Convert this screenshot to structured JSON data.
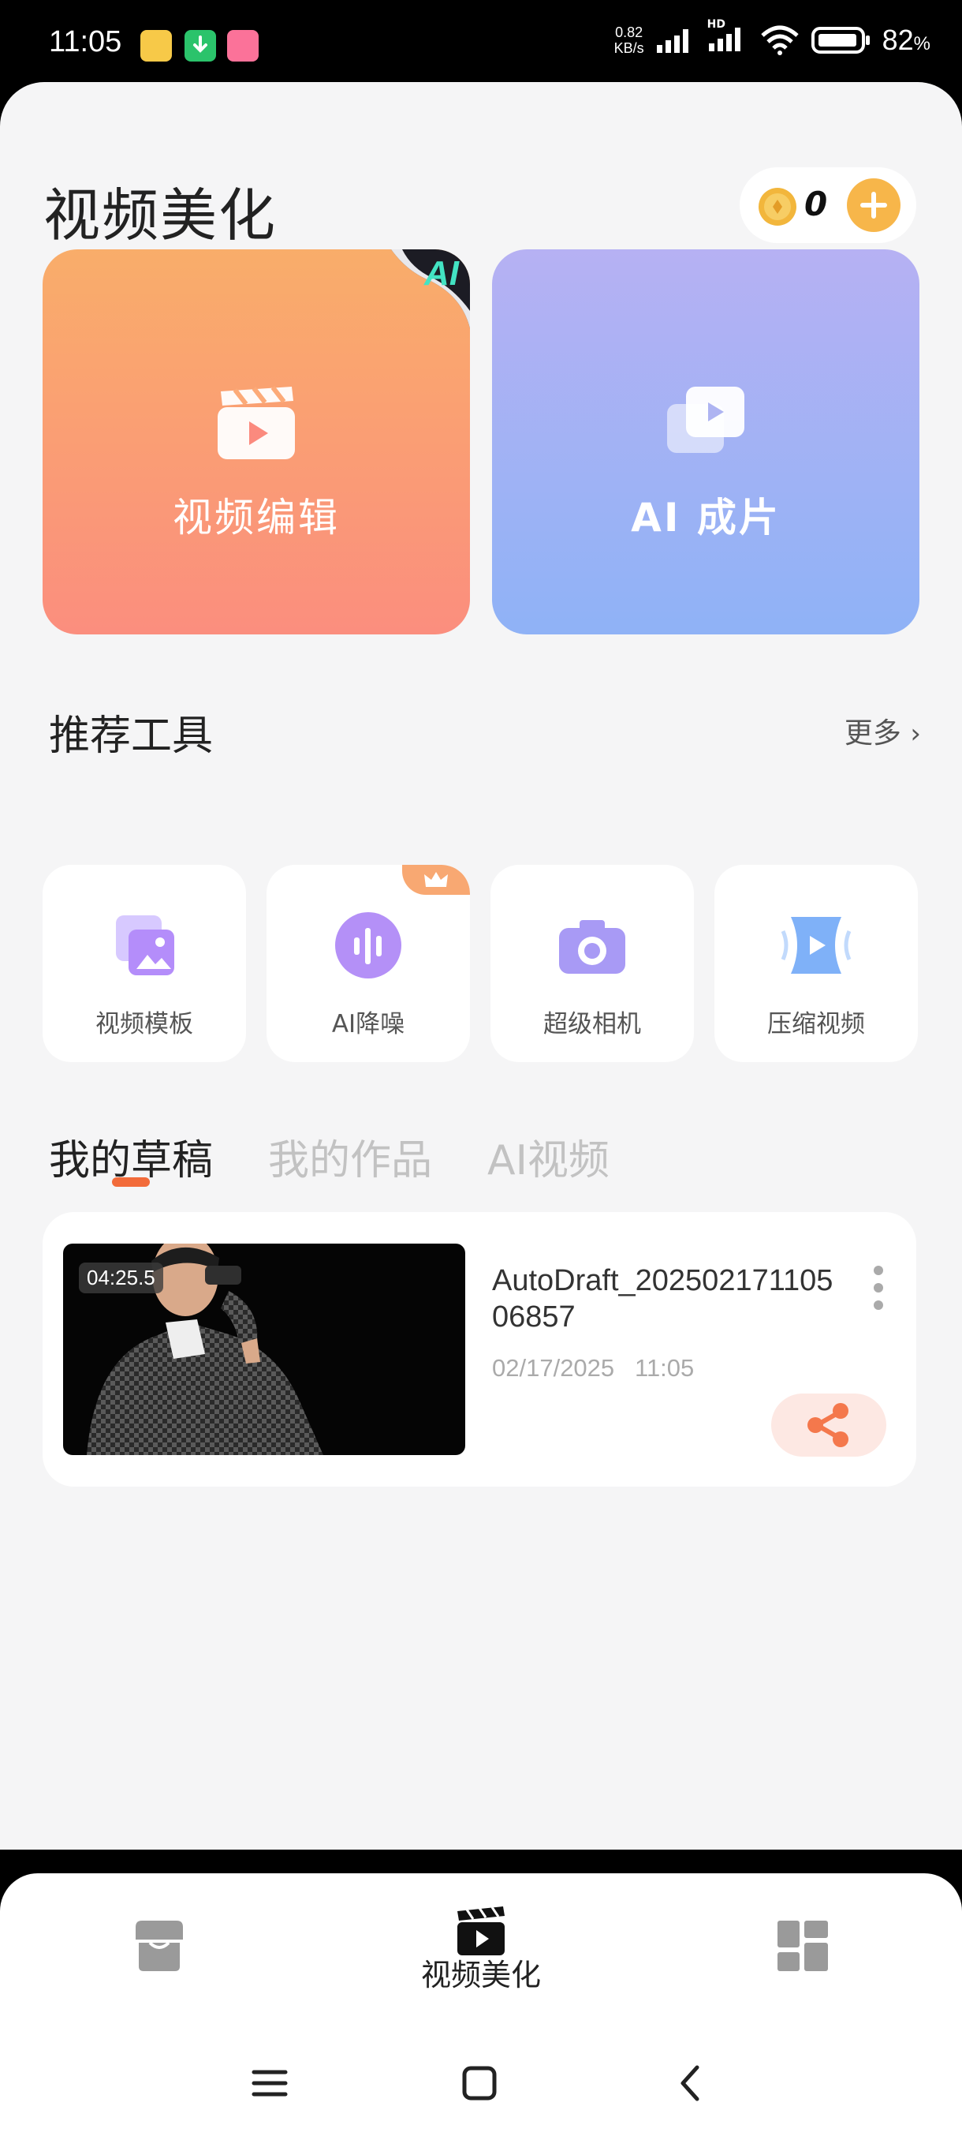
{
  "status_bar": {
    "time": "11:05",
    "net_speed_value": "0.82",
    "net_speed_unit": "KB/s",
    "battery": "82",
    "battery_unit": "%",
    "hd_label": "HD"
  },
  "header": {
    "title": "视频美化",
    "coins": "0"
  },
  "cards": {
    "edit_label": "视频编辑",
    "ai_badge": "AI",
    "ai_label": "AI 成片"
  },
  "tools_section": {
    "title": "推荐工具",
    "more": "更多",
    "items": [
      {
        "label": "视频模板",
        "icon": "template-icon"
      },
      {
        "label": "AI降噪",
        "icon": "waveform-icon"
      },
      {
        "label": "超级相机",
        "icon": "camera-icon"
      },
      {
        "label": "压缩视频",
        "icon": "compress-icon"
      }
    ]
  },
  "tabs": [
    "我的草稿",
    "我的作品",
    "AI视频"
  ],
  "draft": {
    "duration": "04:25.5",
    "name": "AutoDraft_20250217110506857",
    "date": "02/17/2025",
    "time": "11:05"
  },
  "bottom_nav": {
    "active_label": "视频美化",
    "items": [
      "store-icon",
      "clapper-icon",
      "grid-icon"
    ]
  },
  "colors": {
    "accent": "#f26b3a",
    "coin": "#f7b64a",
    "edit_card_top": "#f9ad6a",
    "ai_card_top": "#b6b1f3"
  }
}
